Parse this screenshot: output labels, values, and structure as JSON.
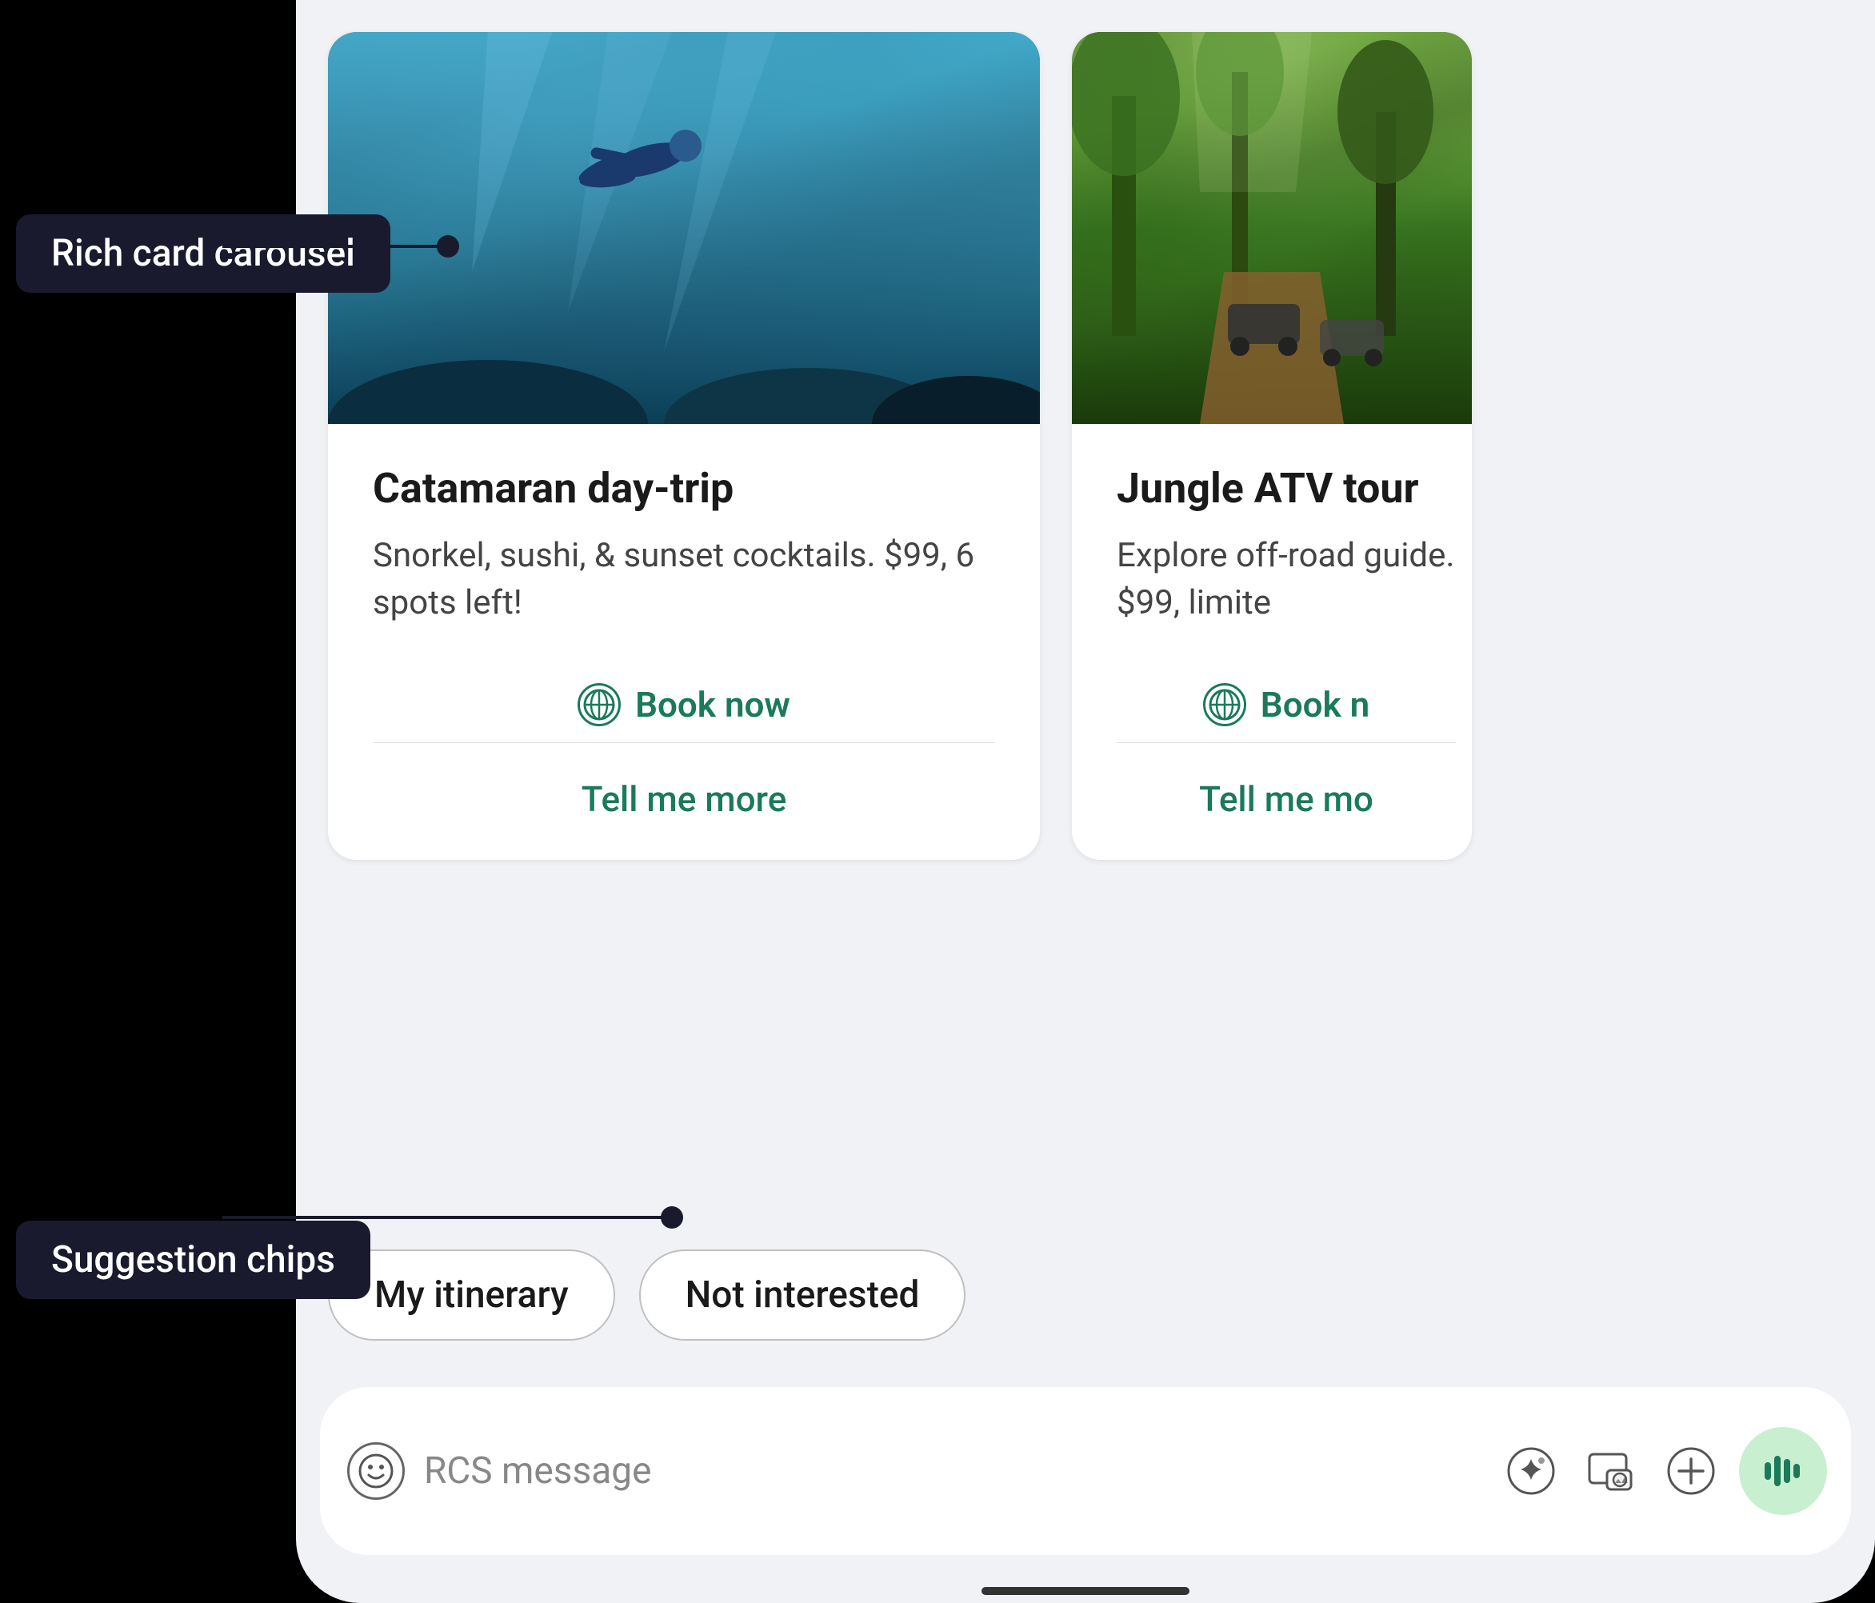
{
  "annotations": {
    "rich_card_label": "Rich card carousel",
    "suggestion_chips_label": "Suggestion chips"
  },
  "cards": [
    {
      "id": "card-1",
      "title": "Catamaran day-trip",
      "description": "Snorkel, sushi, & sunset cocktails. $99, 6 spots left!",
      "action_label": "Book now",
      "secondary_action": "Tell me more",
      "image_type": "underwater"
    },
    {
      "id": "card-2",
      "title": "Jungle ATV tour",
      "description": "Explore off-road guide. $99, limite",
      "action_label": "Book n",
      "secondary_action": "Tell me mo",
      "image_type": "jungle"
    }
  ],
  "chips": [
    {
      "label": "My itinerary"
    },
    {
      "label": "Not interested"
    }
  ],
  "message_input": {
    "placeholder": "RCS message"
  },
  "icons": {
    "emoji": "☺",
    "voice": "🎤"
  }
}
